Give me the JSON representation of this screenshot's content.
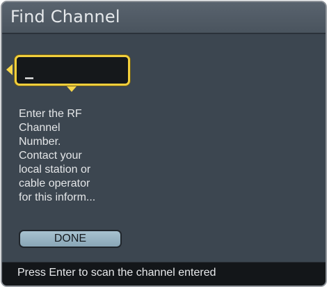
{
  "dialog": {
    "title": "Find Channel",
    "input": {
      "value": "_"
    },
    "instructions": "Enter the RF\nChannel\nNumber.\nContact your\nlocal station or\ncable operator\nfor this inform...",
    "done_label": "DONE",
    "status": "Press Enter to scan the channel entered"
  },
  "colors": {
    "focus_accent": "#f2cf3c",
    "button": "#9bb6c5",
    "panel": "#3c4650",
    "status_bar": "#131619"
  }
}
